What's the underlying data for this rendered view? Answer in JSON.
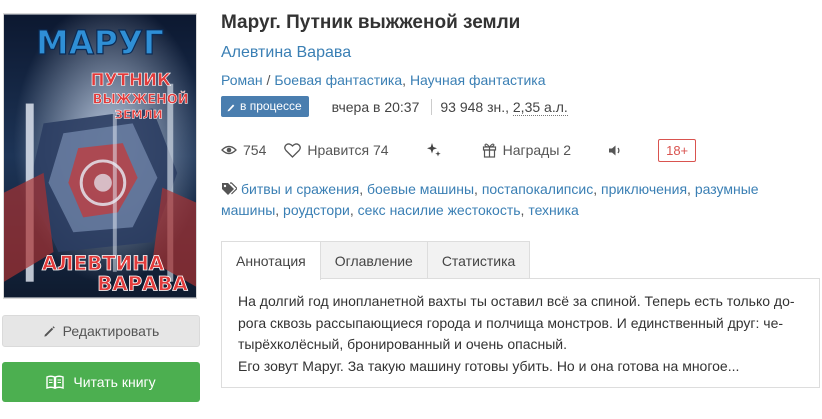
{
  "cover": {
    "title_line1": "МАРУГ",
    "title_line2": "ПУТНИК",
    "title_line3": "ВЫЖЖЕНОЙ",
    "title_line4": "ЗЕМЛИ",
    "author_line1": "АЛЕВТИНА",
    "author_line2": "ВАРАВА"
  },
  "buttons": {
    "edit_label": "Редактировать",
    "read_label": "Читать книгу"
  },
  "book": {
    "title": "Маруг. Путник выжженой земли",
    "author": "Алевтина Варава",
    "genres": [
      "Роман",
      "Боевая фантастика",
      "Научная фантастика"
    ],
    "genre_sep": " / ",
    "genre_comma": ", ",
    "status": "в процессе",
    "updated": "вчера в 20:37",
    "size_chars": "93 948 зн., ",
    "size_al": "2,35 а.л."
  },
  "stats": {
    "views": "754",
    "likes": "Нравится 74",
    "awards": "Награды 2",
    "age": "18+"
  },
  "tags": [
    "битвы и сражения",
    "боевые машины",
    "постапокалипсис",
    "приключения",
    "разумные машины",
    "роудстори",
    "секс насилие жестокость",
    "техника"
  ],
  "tabs": [
    "Аннотация",
    "Оглавление",
    "Статистика"
  ],
  "annotation": [
    "На долгий год инопланетной вахты ты оставил всё за спиной. Теперь есть только до-",
    "рога сквозь рассыпающиеся города и полчища монстров. И единственный друг: че-",
    "тырёхколёсный, бронированный и очень опасный.",
    "Его зовут Маруг. За такую машину готовы убить. Но и она готова на многое..."
  ],
  "colors": {
    "link": "#3a7fb4",
    "badge": "#4a7eaf",
    "read_button": "#4caf50",
    "age_badge": "#d9534f"
  }
}
